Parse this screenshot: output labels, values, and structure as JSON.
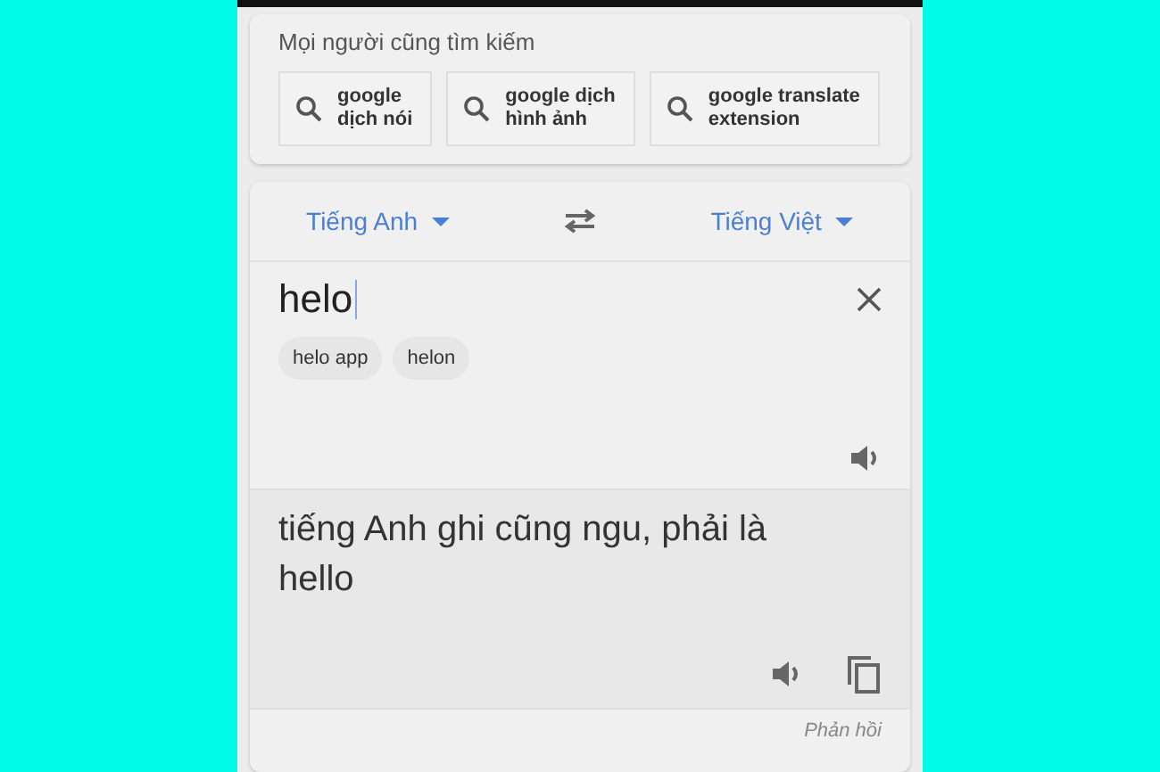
{
  "related": {
    "title": "Mọi người cũng tìm kiếm",
    "items": [
      "google\ndịch nói",
      "google dịch\nhình ảnh",
      "google translate\nextension"
    ]
  },
  "languages": {
    "source": "Tiếng Anh",
    "target": "Tiếng Việt"
  },
  "input": {
    "value": "helo",
    "suggestions": [
      "helo app",
      "helon"
    ]
  },
  "output": {
    "text": "tiếng Anh ghi cũng ngu, phải là hello"
  },
  "feedback": "Phản hồi"
}
